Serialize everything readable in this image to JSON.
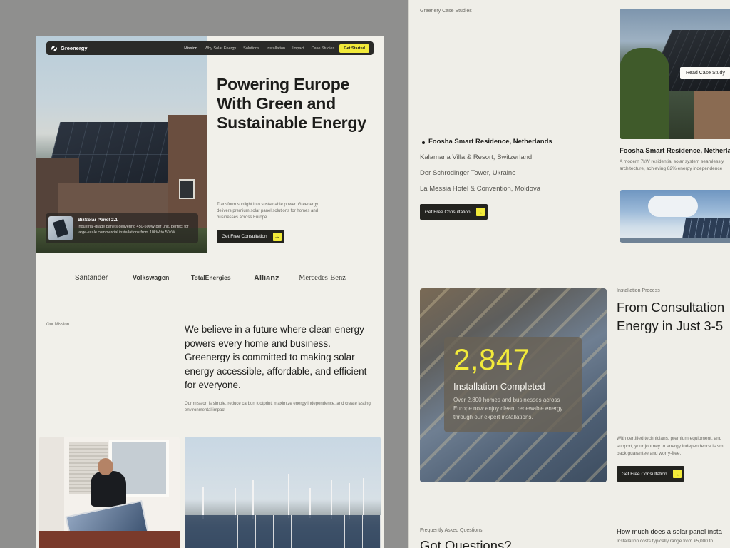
{
  "nav": {
    "brand": "Greenergy",
    "links": [
      "Mission",
      "Why Solar Energy",
      "Solutions",
      "Installation",
      "Impact",
      "Case Studies"
    ],
    "cta": "Get Started"
  },
  "hero": {
    "title": "Powering Europe With Green and Sustainable Energy",
    "description": "Transform sunlight into sustainable power. Greenergy delivers premium solar panel solutions for homes and businesses across Europe",
    "cta": "Get Free Consultation",
    "product": {
      "name": "BizSolar Panel 2.1",
      "description": "Industrial-grade panels delivering 450-500W per unit, perfect for large-scale commercial installations from 10kW to 50kW."
    }
  },
  "brands": [
    "Santander",
    "Volkswagen",
    "TotalEnergies",
    "Allianz",
    "Mercedes-Benz"
  ],
  "mission": {
    "label": "Our Mission",
    "statement": "We believe in a future where clean energy powers every home and business. Greenergy is committed to making solar energy accessible, affordable, and efficient for everyone.",
    "sub": "Our mission is simple, reduce carbon footprint, maximize energy independence, and create lasting environmental impact"
  },
  "case_studies": {
    "label": "Greenery Case Studies",
    "items": [
      "Foosha Smart Residence, Netherlands",
      "Kalamana Villa & Resort, Switzerland",
      "Der Schrodinger Tower, Ukraine",
      "La Messia Hotel & Convention, Moldova"
    ],
    "cta": "Get Free Consultation",
    "read_button": "Read Case Study",
    "featured_name": "Foosha Smart Residence, Netherlands",
    "featured_desc_1": "A modern 7kW residential solar system seamlessly",
    "featured_desc_2": "architecture, achieving 82% energy independence"
  },
  "stats": {
    "number": "2,847",
    "title": "Installation Completed",
    "description": "Over 2,800 homes and businesses across Europe now enjoy clean, renewable energy through our expert installations."
  },
  "installation": {
    "label": "Installation Process",
    "title_1": "From Consultation",
    "title_2": "Energy in Just 3-5",
    "desc_1": "With certified technicians, premium equipment, and",
    "desc_2": "support, your journey to energy independence is sm",
    "desc_3": "back guarantee and worry-free.",
    "cta": "Get Free Consultation"
  },
  "faq": {
    "label": "Frequently Asked Questions",
    "title": "Got Questions?",
    "question": "How much does a solar panel insta",
    "answer": "Installation costs typically range from €5,000 to"
  },
  "colors": {
    "accent": "#f2ea3a",
    "dark": "#23231f",
    "page_bg": "#f1f0ea",
    "backdrop": "#8f8f8e"
  }
}
